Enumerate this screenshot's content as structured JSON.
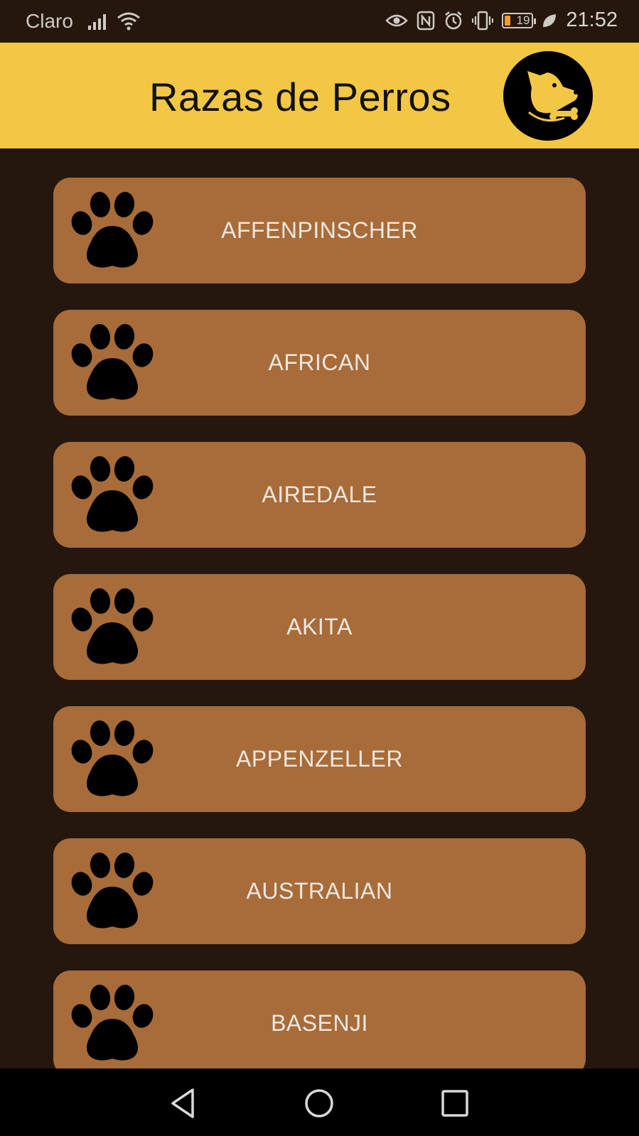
{
  "status_bar": {
    "carrier": "Claro",
    "battery_level": "19",
    "time": "21:52",
    "icons": [
      "signal-icon",
      "wifi-icon",
      "eye-icon",
      "nfc-icon",
      "alarm-icon",
      "vibrate-icon",
      "battery-icon",
      "leaf-icon"
    ]
  },
  "app_bar": {
    "title": "Razas de Perros",
    "background": "#f2c744",
    "logo_icon": "dog-logo-icon"
  },
  "breeds": [
    {
      "name": "AFFENPINSCHER",
      "icon": "paw-icon"
    },
    {
      "name": "AFRICAN",
      "icon": "paw-icon"
    },
    {
      "name": "AIREDALE",
      "icon": "paw-icon"
    },
    {
      "name": "AKITA",
      "icon": "paw-icon"
    },
    {
      "name": "APPENZELLER",
      "icon": "paw-icon"
    },
    {
      "name": "AUSTRALIAN",
      "icon": "paw-icon"
    },
    {
      "name": "BASENJI",
      "icon": "paw-icon"
    }
  ],
  "colors": {
    "background": "#25170d",
    "item_background": "#a76c39",
    "item_text": "#efe7e0"
  },
  "nav_bar": {
    "buttons": [
      "back-icon",
      "home-icon",
      "recents-icon"
    ]
  }
}
